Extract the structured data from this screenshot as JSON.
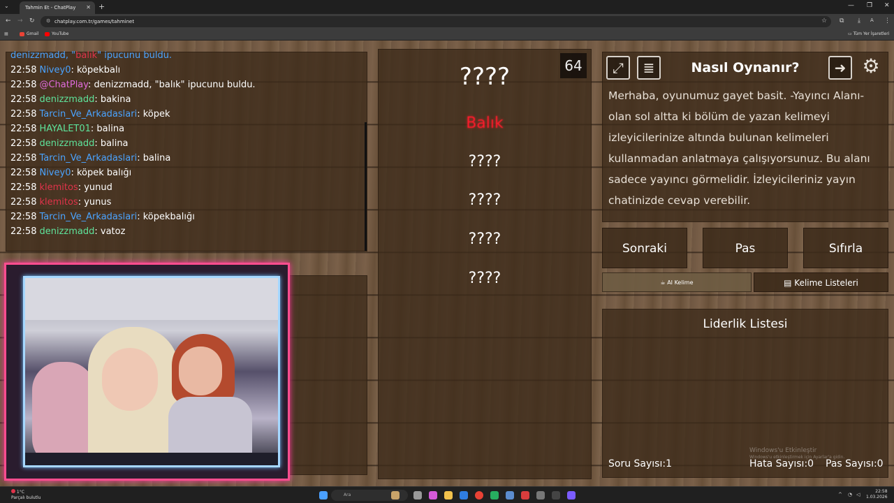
{
  "browser": {
    "tab_title": "Tahmin Et - ChatPlay",
    "url": "chatplay.com.tr/games/tahminet",
    "bookmarks": [
      {
        "label": "Gmail",
        "color": "#ea4335"
      },
      {
        "label": "YouTube",
        "color": "#ff0000"
      }
    ],
    "all_bookmarks": "Tüm Yer İşaretleri",
    "profile_letter": "A"
  },
  "chat": {
    "partial_top": {
      "user": "denizzmadd",
      "mid": ", \"",
      "word": "balık",
      "rest": "\" ipucunu buldu."
    },
    "lines": [
      {
        "time": "22:58",
        "user": "Nivey0",
        "color": "blue",
        "text": ": köpekbalı"
      },
      {
        "time": "22:58",
        "user": "@ChatPlay",
        "color": "purple",
        "text": ": denizzmadd, \"balık\" ipucunu buldu."
      },
      {
        "time": "22:58",
        "user": "denizzmadd",
        "color": "green",
        "text": ": bakina"
      },
      {
        "time": "22:58",
        "user": "Tarcin_Ve_Arkadaslari",
        "color": "blue",
        "text": ": köpek"
      },
      {
        "time": "22:58",
        "user": "HAYALET01",
        "color": "green",
        "text": ": balina"
      },
      {
        "time": "22:58",
        "user": "denizzmadd",
        "color": "green",
        "text": ": balina"
      },
      {
        "time": "22:58",
        "user": "Tarcin_Ve_Arkadaslari",
        "color": "blue",
        "text": ": balina"
      },
      {
        "time": "22:58",
        "user": "Nivey0",
        "color": "blue",
        "text": ": köpek balığı"
      },
      {
        "time": "22:58",
        "user": "klemitos",
        "color": "red",
        "text": ": yunud"
      },
      {
        "time": "22:58",
        "user": "klemitos",
        "color": "red",
        "text": ": yunus"
      },
      {
        "time": "22:58",
        "user": "Tarcin_Ve_Arkadaslari",
        "color": "blue",
        "text": ": köpekbalığı"
      },
      {
        "time": "22:58",
        "user": "denizzmadd",
        "color": "green",
        "text": ": vatoz"
      }
    ]
  },
  "game": {
    "timer": "64",
    "main_word": "????",
    "revealed_word": "Balık",
    "hidden_words": [
      "????",
      "????",
      "????",
      "????"
    ]
  },
  "howto": {
    "title": "Nasıl Oynanır?",
    "body": "Merhaba, oyunumuz gayet basit. -Yayıncı Alanı- olan sol altta ki bölüm de yazan kelimeyi izleyicilerinize altında bulunan kelimeleri kullanmadan anlatmaya çalışıyorsunuz. Bu alanı sadece yayıncı görmelidir. İzleyicileriniz yayın chatinizde cevap verebilir."
  },
  "buttons": {
    "next": "Sonraki",
    "pass": "Pas",
    "reset": "Sıfırla",
    "ai_word": "AI Kelime",
    "word_lists": "Kelime Listeleri"
  },
  "leaderboard": {
    "title": "Liderlik Listesi"
  },
  "stats": {
    "questions": "Soru Sayısı:1",
    "errors": "Hata Sayısı:0",
    "passes": "Pas Sayısı:0"
  },
  "watermark": {
    "line1": "Windows'u Etkinleştir",
    "line2": "Windows'u etkinleştirmek için Ayarlar'a gidin."
  },
  "taskbar": {
    "temp": "1°C",
    "weather": "Parçalı bulutlu",
    "search": "Ara",
    "time": "22:58",
    "date": "1.03.2026"
  }
}
